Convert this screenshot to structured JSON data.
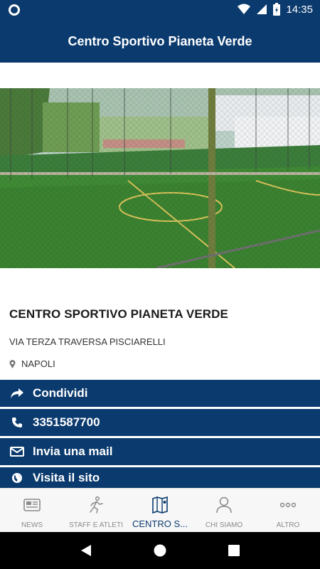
{
  "status_bar": {
    "time": "14:35",
    "icons": [
      "notification-icon",
      "wifi-icon",
      "cell-signal-icon",
      "battery-icon"
    ]
  },
  "app_bar": {
    "title": "Centro Sportivo Pianeta Verde"
  },
  "hero": {
    "description": "green-soccer-field-photo"
  },
  "info": {
    "name": "CENTRO SPORTIVO PIANETA VERDE",
    "address": "VIA TERZA TRAVERSA PISCIARELLI",
    "city": "NAPOLI",
    "city_icon": "location-pin-icon"
  },
  "actions": [
    {
      "icon": "share-icon",
      "label": "Condividi"
    },
    {
      "icon": "phone-icon",
      "label": "3351587700"
    },
    {
      "icon": "mail-icon",
      "label": "Invia una mail"
    },
    {
      "icon": "globe-icon",
      "label": "Visita il sito"
    }
  ],
  "bottom_nav": [
    {
      "icon": "news-icon",
      "label": "NEWS",
      "active": false
    },
    {
      "icon": "runner-icon",
      "label": "STAFF E ATLETI",
      "active": false
    },
    {
      "icon": "map-icon",
      "label": "CENTRO S...",
      "active": true
    },
    {
      "icon": "person-icon",
      "label": "CHI SIAMO",
      "active": false
    },
    {
      "icon": "more-icon",
      "label": "ALTRO",
      "active": false
    }
  ],
  "colors": {
    "primary": "#0b3a6e",
    "nav_background": "#f7f7f7",
    "nav_inactive": "#8a8a8a"
  }
}
